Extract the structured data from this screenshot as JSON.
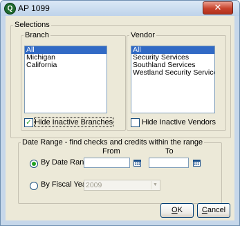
{
  "window": {
    "title": "AP 1099",
    "close_glyph": "✕",
    "app_icon": "Q"
  },
  "selections": {
    "label": "Selections",
    "branch": {
      "label": "Branch",
      "items": [
        "All",
        "Michigan",
        "California"
      ],
      "selected_index": 0,
      "hide_inactive_label": "Hide Inactive Branches",
      "hide_inactive_checked": true
    },
    "vendor": {
      "label": "Vendor",
      "items": [
        "All",
        "Security Services",
        "Southland Services",
        "Westland Security Services"
      ],
      "selected_index": 0,
      "hide_inactive_label": "Hide Inactive Vendors",
      "hide_inactive_checked": false
    }
  },
  "date_range": {
    "label": "Date Range - find checks and credits within the range",
    "from_label": "From",
    "to_label": "To",
    "from_value": "",
    "to_value": "",
    "by_date_range_label": "By Date Range",
    "by_date_range_selected": true,
    "by_fiscal_year_label": "By Fiscal Year",
    "by_fiscal_year_selected": false,
    "fiscal_year_value": "2009"
  },
  "buttons": {
    "ok": {
      "mnemonic": "O",
      "rest": "K"
    },
    "cancel": {
      "mnemonic": "C",
      "rest": "ancel"
    }
  },
  "icons": {
    "app": "app-logo-icon",
    "close": "close-icon",
    "calendar": "calendar-icon",
    "check": "checkmark-icon",
    "dropdown": "chevron-down-icon"
  },
  "colors": {
    "selection": "#316ac5",
    "check_green": "#21a121",
    "close_red": "#c7432c"
  }
}
